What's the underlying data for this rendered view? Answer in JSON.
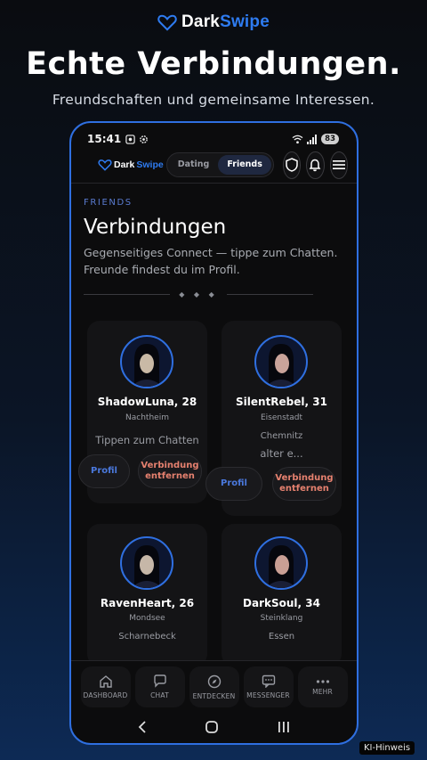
{
  "brand": {
    "part1": "Dark",
    "part2": "Swipe",
    "accent": "#2e7bf0"
  },
  "headline": "Echte Verbindungen.",
  "subline": "Freundschaften und gemeinsame Interessen.",
  "status": {
    "time": "15:41",
    "battery": "83"
  },
  "appbar": {
    "brand_part1": "Dark",
    "brand_part2": "Swipe",
    "tabs": [
      {
        "label": "Dating",
        "active": false
      },
      {
        "label": "Friends",
        "active": true
      }
    ],
    "icons": [
      "shield-icon",
      "bell-icon",
      "menu-icon"
    ]
  },
  "page": {
    "eyebrow": "FRIENDS",
    "title": "Verbindungen",
    "desc": "Gegenseitiges Connect — tippe zum Chatten. Freunde findest du im Profil.",
    "ornament": "◆ ◆ ◆"
  },
  "cards": [
    {
      "name": "ShadowLuna, 28",
      "location": "Nachtheim",
      "note": "Tippen zum Chatten",
      "profile": "Profil",
      "remove": "Verbindung entfernen"
    },
    {
      "name": "SilentRebel, 31",
      "location": "Eisenstadt",
      "note1": "Chemnitz",
      "note2": "alter e...",
      "profile": "Profil",
      "remove": "Verbindung entfernen"
    },
    {
      "name": "RavenHeart, 26",
      "location": "Mondsee",
      "note": "Scharnebeck"
    },
    {
      "name": "DarkSoul, 34",
      "location": "Steinklang",
      "note": "Essen"
    }
  ],
  "bottom_nav": [
    {
      "label": "DASHBOARD",
      "icon": "home-icon"
    },
    {
      "label": "CHAT",
      "icon": "chat-icon"
    },
    {
      "label": "ENTDECKEN",
      "icon": "compass-icon"
    },
    {
      "label": "MESSENGER",
      "icon": "message-icon"
    },
    {
      "label": "MEHR",
      "icon": "more-icon"
    }
  ],
  "ki_label": "KI-Hinweis"
}
